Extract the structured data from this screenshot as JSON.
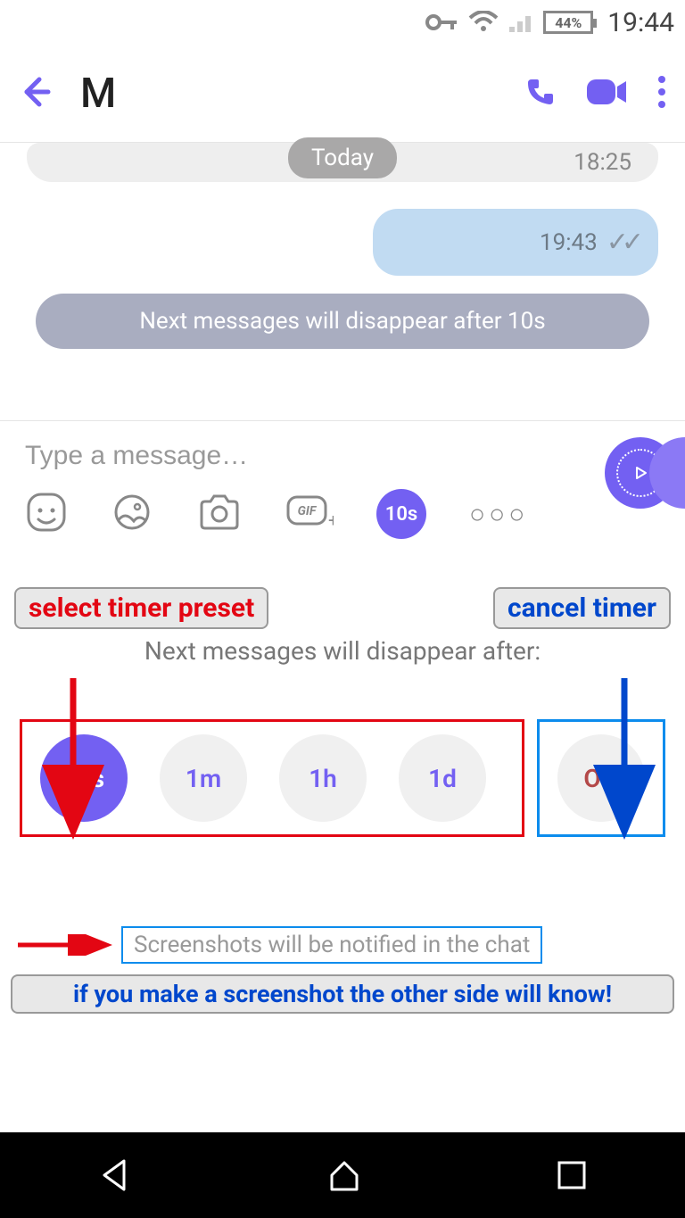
{
  "status": {
    "battery": "44%",
    "time": "19:44"
  },
  "app_bar": {
    "contact": "M"
  },
  "chat": {
    "date_label": "Today",
    "prev_time": "18:25",
    "sent_time": "19:43",
    "system_msg": "Next messages will disappear after 10s"
  },
  "composer": {
    "placeholder": "Type a message…",
    "timer_chip": "10s"
  },
  "annotations": {
    "select_preset": "select timer preset",
    "cancel_timer": "cancel timer",
    "warning": "if you make a screenshot the other side will know!"
  },
  "timer_panel": {
    "description": "Next messages will disappear after:",
    "presets": [
      "10s",
      "1m",
      "1h",
      "1d"
    ],
    "off": "Off",
    "selected": "10s"
  },
  "notice": "Screenshots will be notified in the chat"
}
